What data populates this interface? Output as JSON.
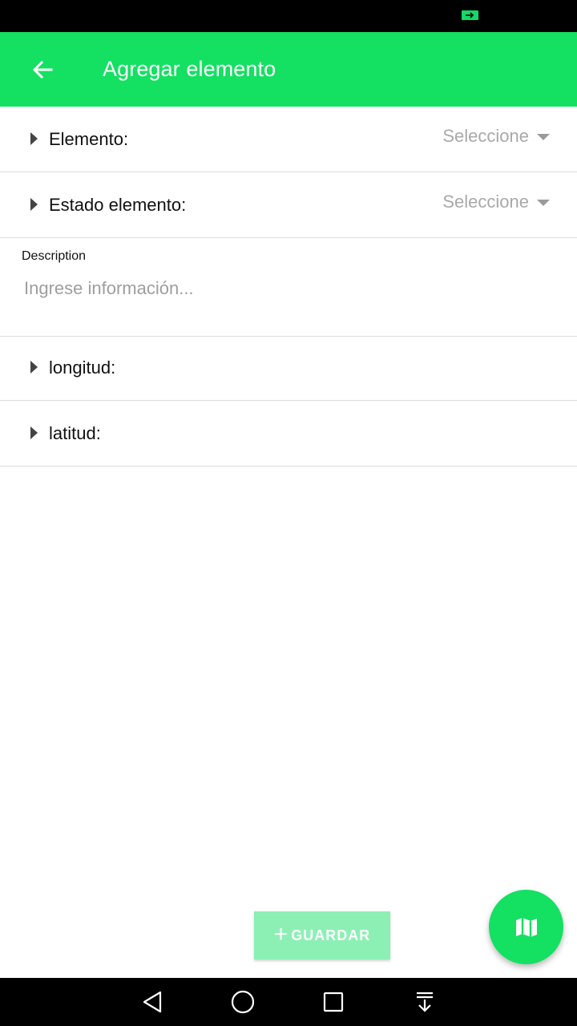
{
  "app_bar": {
    "title": "Agregar elemento"
  },
  "form": {
    "elemento": {
      "label": "Elemento:",
      "value": "Seleccione"
    },
    "estado": {
      "label": "Estado elemento:",
      "value": "Seleccione"
    },
    "description": {
      "label": "Description",
      "placeholder": "Ingrese información..."
    },
    "longitud": {
      "label": "longitud:"
    },
    "latitud": {
      "label": "latitud:"
    }
  },
  "actions": {
    "save_label": "GUARDAR"
  },
  "icons": {
    "back": "arrow-left-icon",
    "expand": "caret-right-icon",
    "dropdown": "caret-down-icon",
    "fab": "map-icon",
    "save": "plus-icon"
  },
  "colors": {
    "primary": "#14e062",
    "save_disabled": "#8cf0b4"
  }
}
